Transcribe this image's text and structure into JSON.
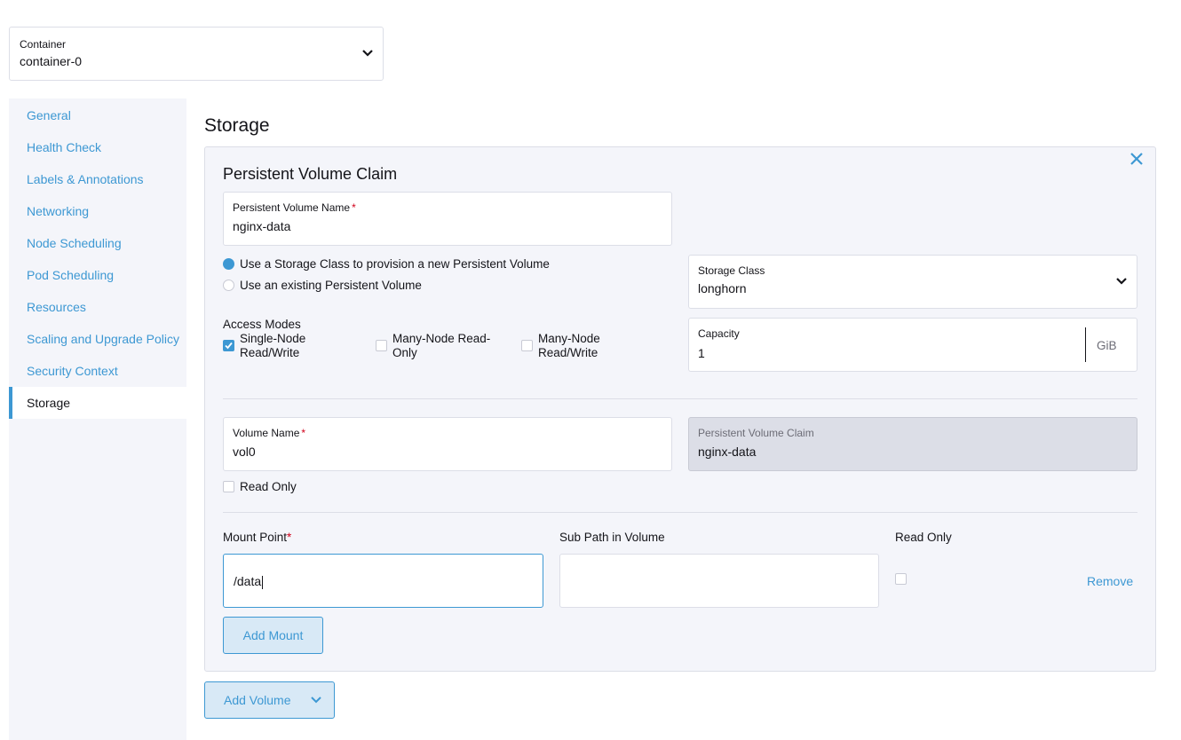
{
  "container": {
    "label": "Container",
    "value": "container-0"
  },
  "sidenav": {
    "items": [
      {
        "label": "General"
      },
      {
        "label": "Health Check"
      },
      {
        "label": "Labels & Annotations"
      },
      {
        "label": "Networking"
      },
      {
        "label": "Node Scheduling"
      },
      {
        "label": "Pod Scheduling"
      },
      {
        "label": "Resources"
      },
      {
        "label": "Scaling and Upgrade Policy"
      },
      {
        "label": "Security Context"
      },
      {
        "label": "Storage"
      }
    ],
    "active": "Storage"
  },
  "main": {
    "title": "Storage",
    "pvc": {
      "title": "Persistent Volume Claim",
      "pv_name_label": "Persistent Volume Name",
      "pv_name_value": "nginx-data",
      "radio_storage_class": "Use a Storage Class to provision a new Persistent Volume",
      "radio_existing": "Use an existing Persistent Volume",
      "storage_class_label": "Storage Class",
      "storage_class_value": "longhorn",
      "access_modes_label": "Access Modes",
      "access_modes": [
        {
          "label_line1": "Single-Node",
          "label_line2": "Read/Write",
          "checked": true
        },
        {
          "label_line1": "Many-Node Read-",
          "label_line2": "Only",
          "checked": false
        },
        {
          "label_line1": "Many-Node",
          "label_line2": "Read/Write",
          "checked": false
        }
      ],
      "capacity_label": "Capacity",
      "capacity_value": "1",
      "capacity_unit": "GiB"
    },
    "volume": {
      "name_label": "Volume Name",
      "name_value": "vol0",
      "pvc_label": "Persistent Volume Claim",
      "pvc_value": "nginx-data",
      "read_only_label": "Read Only"
    },
    "mounts": {
      "mount_point_label": "Mount Point",
      "sub_path_label": "Sub Path in Volume",
      "read_only_label": "Read Only",
      "mount_point_value": "/data",
      "sub_path_value": "",
      "remove_label": "Remove",
      "add_mount_label": "Add Mount"
    },
    "add_volume_label": "Add Volume"
  },
  "colors": {
    "accent": "#3d98d3",
    "required": "#d0021b",
    "nav_bg": "#f4f5fa",
    "border": "#dcdee7"
  }
}
